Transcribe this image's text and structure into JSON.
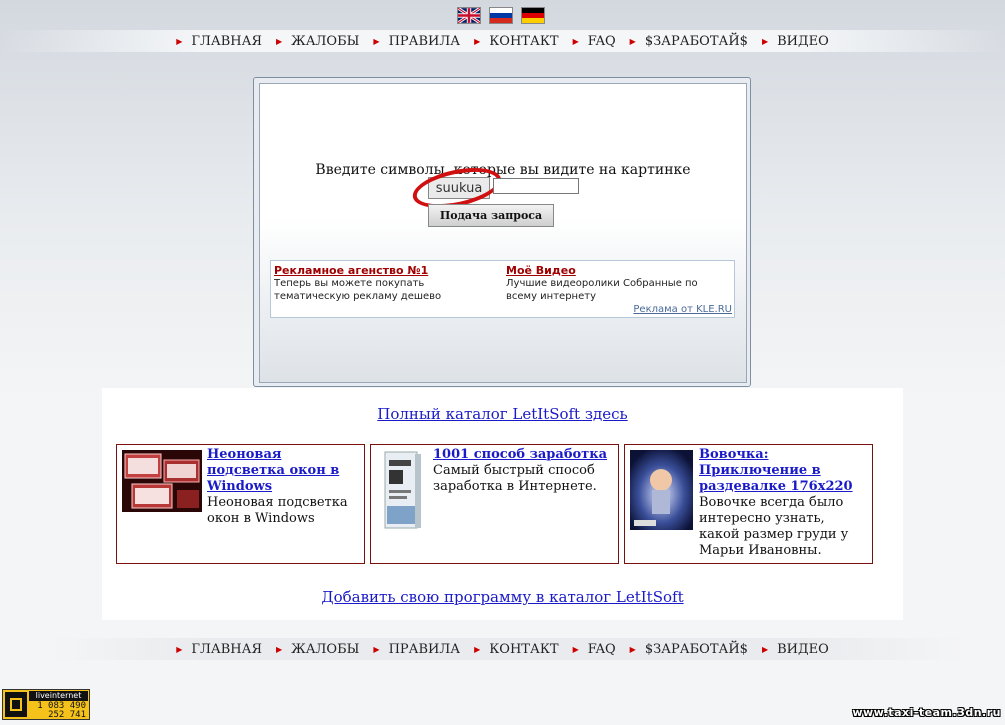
{
  "languages": [
    {
      "name": "English",
      "icon": "uk-flag-icon"
    },
    {
      "name": "Русский",
      "icon": "russia-flag-icon"
    },
    {
      "name": "Deutsch",
      "icon": "germany-flag-icon"
    }
  ],
  "nav": {
    "items": [
      "ГЛАВНАЯ",
      "ЖАЛОБЫ",
      "ПРАВИЛА",
      "КОНТАКТ",
      "FAQ",
      "$ЗАРАБОТАЙ$",
      "ВИДЕО"
    ]
  },
  "captcha": {
    "prompt": "Введите символы, которые вы видите на картинке",
    "image_text": "suukua",
    "input_value": "",
    "submit_label": "Подача запроса"
  },
  "ads": {
    "items": [
      {
        "title": "Рекламное агенство №1",
        "desc": "Теперь вы можете покупать тематическую рекламу дешево"
      },
      {
        "title": "Моё Видео",
        "desc": "Лучшие видеоролики Собранные по всему интернету"
      }
    ],
    "credit": "Реклама от KLE.RU"
  },
  "catalog": {
    "full_link": "Полный каталог LetItSoft здесь",
    "add_link": "Добавить свою программу в каталог LetItSoft",
    "cards": [
      {
        "title": "Неоновая подсветка окон в Windows",
        "desc": "Неоновая подсветка окон в Windows"
      },
      {
        "title": "1001 способ заработка",
        "desc": "Самый быстрый способ заработка в Интернете."
      },
      {
        "title": "Вовочка: Приключение в раздевалке 176x220",
        "desc": "Вовочке всегда было интересно узнать, какой размер груди у Марьи Ивановны."
      }
    ]
  },
  "counter": {
    "name": "liveinternet",
    "value1": "1 083 490",
    "value2": "252 741"
  },
  "watermark": "www.taxi-team.3dn.ru",
  "colors": {
    "nav_arrow": "#cc0000",
    "link": "#1a1ac8",
    "ad_title": "#a00000",
    "card_border": "#7a1010",
    "captcha_ring": "#d01010"
  }
}
